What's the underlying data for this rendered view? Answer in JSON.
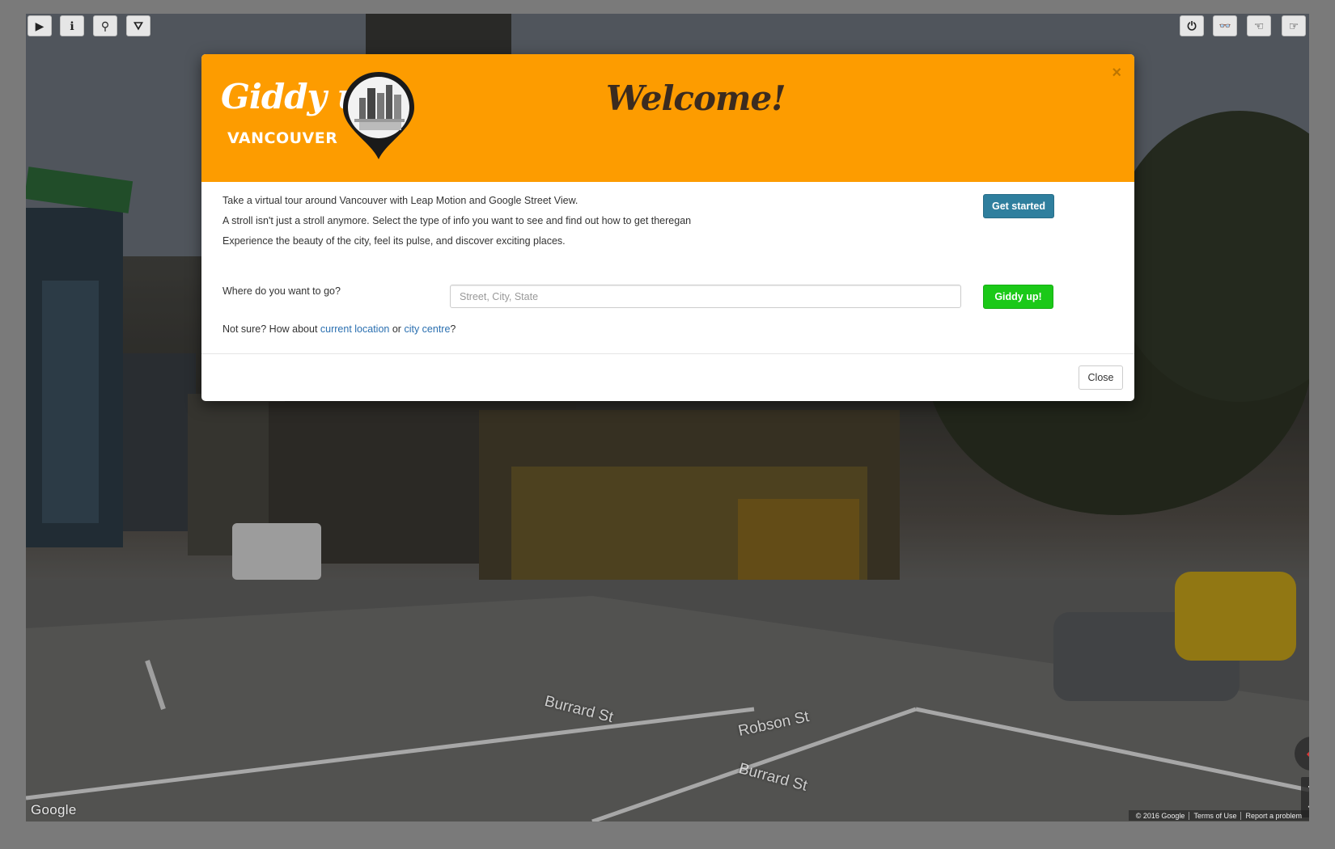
{
  "toolbar_left": [
    {
      "icon": "play-icon",
      "glyph": "▶"
    },
    {
      "icon": "info-icon",
      "glyph": "ℹ"
    },
    {
      "icon": "location-pin-icon",
      "glyph": "⚲"
    },
    {
      "icon": "road-icon",
      "glyph": "⛛"
    }
  ],
  "toolbar_right": [
    {
      "icon": "power-icon",
      "glyph": "⏻"
    },
    {
      "icon": "binoculars-icon",
      "glyph": "👓"
    },
    {
      "icon": "hand-point-left-icon",
      "glyph": "☜"
    },
    {
      "icon": "hand-point-right-icon",
      "glyph": "☞"
    }
  ],
  "street_labels": {
    "burrard_1": "Burrard St",
    "robson": "Robson St",
    "burrard_2": "Burrard St"
  },
  "map_footer": {
    "google_logo": "Google",
    "copyright": "© 2016 Google",
    "terms": "Terms of Use",
    "report": "Report a problem"
  },
  "modal": {
    "logo_title": "Giddy up",
    "logo_subtitle": "VANCOUVER",
    "welcome": "Welcome!",
    "close_x": "×",
    "intro_lines": [
      "Take a virtual tour around Vancouver with Leap Motion and Google Street View.",
      "A stroll isn't just a stroll anymore. Select the type of info you want to see and find out how to get theregan",
      "Experience the beauty of the city, feel its pulse, and discover exciting places."
    ],
    "get_started_label": "Get started",
    "where_label": "Where do you want to go?",
    "input_placeholder": "Street, City, State",
    "input_value": "",
    "giddy_button_label": "Giddy up!",
    "not_sure_prefix": "Not sure? How about ",
    "current_location_link": "current location",
    "or_text": " or ",
    "city_centre_link": "city centre",
    "question_mark": "?",
    "close_button_label": "Close"
  },
  "colors": {
    "header_orange": "#fd9c00",
    "get_started_blue": "#2f7f9e",
    "giddy_green": "#1bc918",
    "link_blue": "#2a6fb0"
  }
}
